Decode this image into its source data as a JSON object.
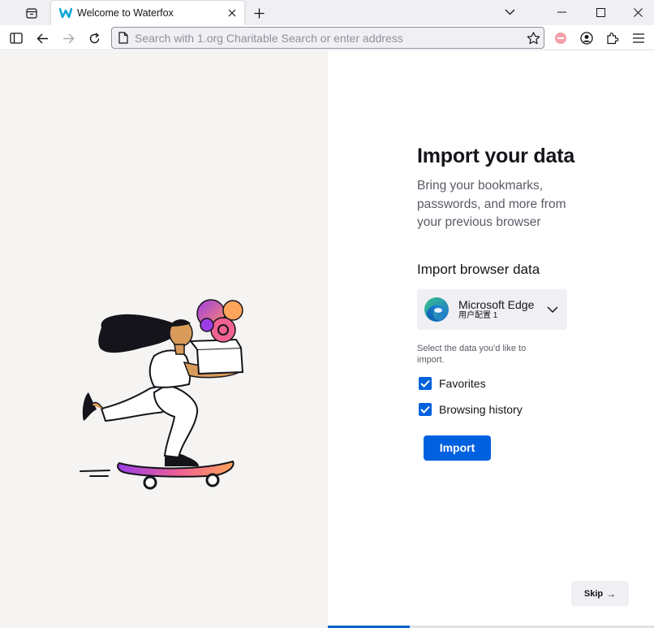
{
  "browser": {
    "tab": {
      "title": "Welcome to Waterfox",
      "favicon": "waterfox-logo-icon"
    },
    "urlbar": {
      "placeholder": "Search with 1.org Charitable Search or enter address",
      "value": ""
    },
    "icons": [
      "tabs-list-icon",
      "close-icon",
      "plus-icon",
      "chevron-down-icon",
      "minimize-icon",
      "maximize-icon",
      "window-close-icon",
      "sidebar-icon",
      "back-icon",
      "forward-icon",
      "reload-icon",
      "page-icon",
      "star-icon",
      "blocked-icon",
      "account-icon",
      "extensions-icon",
      "menu-icon"
    ]
  },
  "page": {
    "heading": "Import your data",
    "subheading": "Bring your bookmarks, passwords, and more from your previous browser",
    "section_title": "Import browser data",
    "source": {
      "name": "Microsoft Edge",
      "profile": "用户配置 1",
      "icon": "edge-logo-icon"
    },
    "select_hint": "Select the data you'd like to import.",
    "options": [
      {
        "label": "Favorites",
        "checked": true
      },
      {
        "label": "Browsing history",
        "checked": true
      }
    ],
    "import_label": "Import",
    "skip_label": "Skip",
    "skip_arrow": "→",
    "progress": 0.25
  },
  "colors": {
    "accent": "#0061e0",
    "panel_bg": "#f5f4f2",
    "chrome_bg": "#f0f0f4"
  }
}
